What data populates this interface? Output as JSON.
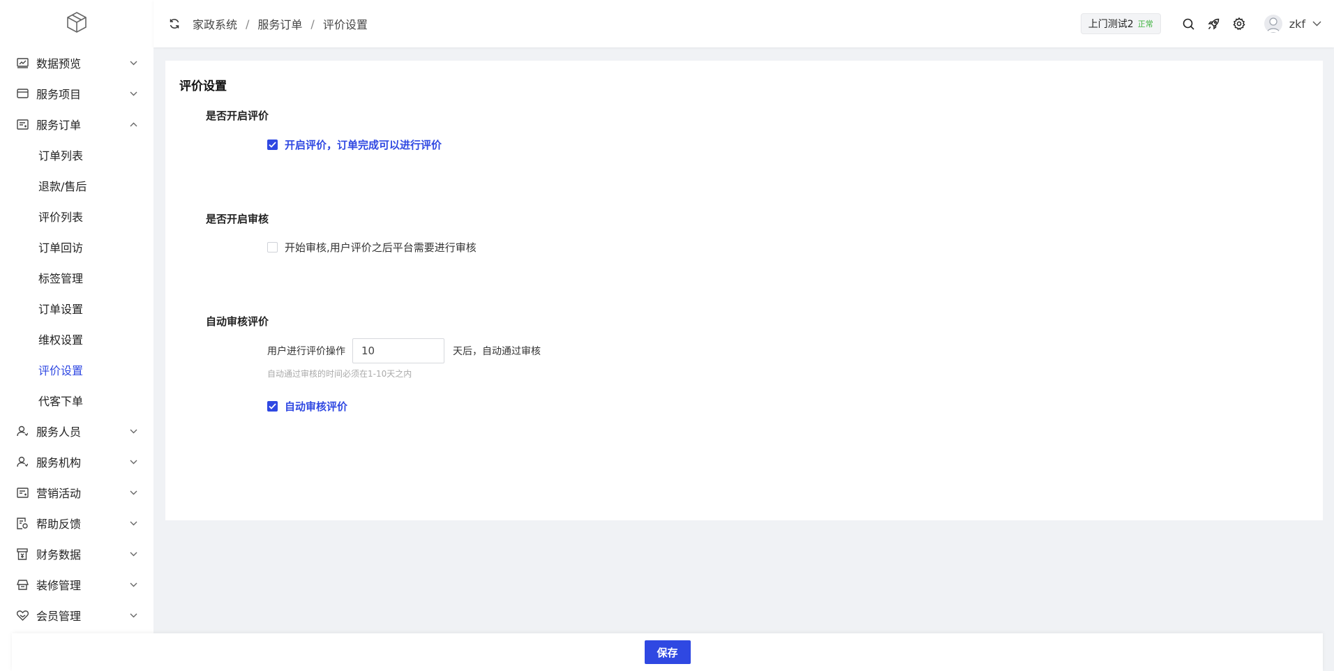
{
  "sidebar": {
    "logo_icon": "cube-icon",
    "items": [
      {
        "label": "数据预览",
        "icon": "chart-icon",
        "expanded": false
      },
      {
        "label": "服务项目",
        "icon": "card-icon",
        "expanded": false
      },
      {
        "label": "服务订单",
        "icon": "order-icon",
        "expanded": true
      },
      {
        "label": "服务人员",
        "icon": "person-icon",
        "expanded": false
      },
      {
        "label": "服务机构",
        "icon": "person-icon",
        "expanded": false
      },
      {
        "label": "营销活动",
        "icon": "campaign-icon",
        "expanded": false
      },
      {
        "label": "帮助反馈",
        "icon": "feedback-icon",
        "expanded": false
      },
      {
        "label": "财务数据",
        "icon": "finance-icon",
        "expanded": false
      },
      {
        "label": "装修管理",
        "icon": "decor-icon",
        "expanded": false
      },
      {
        "label": "会员管理",
        "icon": "heart-icon",
        "expanded": false
      }
    ],
    "submenu": [
      {
        "label": "订单列表",
        "active": false
      },
      {
        "label": "退款/售后",
        "active": false
      },
      {
        "label": "评价列表",
        "active": false
      },
      {
        "label": "订单回访",
        "active": false
      },
      {
        "label": "标签管理",
        "active": false
      },
      {
        "label": "订单设置",
        "active": false
      },
      {
        "label": "维权设置",
        "active": false
      },
      {
        "label": "评价设置",
        "active": true
      },
      {
        "label": "代客下单",
        "active": false
      }
    ]
  },
  "header": {
    "breadcrumb": [
      "家政系统",
      "服务订单",
      "评价设置"
    ],
    "breadcrumb_sep": "/",
    "store_name": "上门测试2",
    "store_status": "正常",
    "user_name": "zkf"
  },
  "card": {
    "title": "评价设置",
    "section1": {
      "title": "是否开启评价",
      "checkbox_label": "开启评价，订单完成可以进行评价",
      "checked": true
    },
    "section2": {
      "title": "是否开启审核",
      "checkbox_label": "开始审核,用户评价之后平台需要进行审核",
      "checked": false
    },
    "section3": {
      "title": "自动审核评价",
      "prefix": "用户进行评价操作",
      "days_value": "10",
      "suffix": "天后，自动通过审核",
      "hint": "自动通过审核的时间必须在1-10天之内",
      "checkbox_label": "自动审核评价",
      "checked": true
    }
  },
  "footer": {
    "save_label": "保存"
  },
  "colors": {
    "accent": "#2f48e2",
    "status_green": "#3fb33f"
  }
}
